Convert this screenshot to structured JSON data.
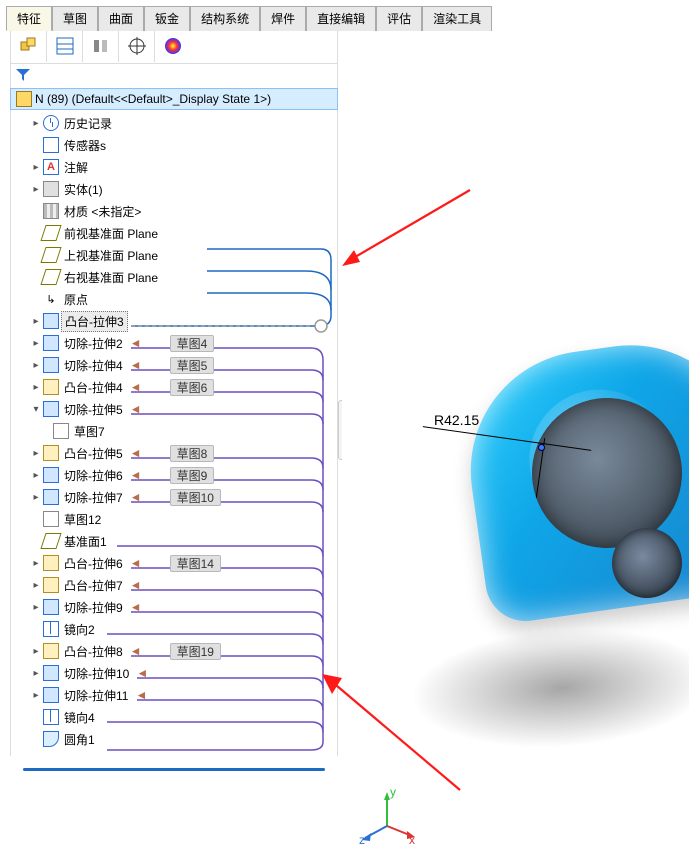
{
  "tabs": {
    "t0": "特征",
    "t1": "草图",
    "t2": "曲面",
    "t3": "钣金",
    "t4": "结构系统",
    "t5": "焊件",
    "t6": "直接编辑",
    "t7": "评估",
    "t8": "渲染工具"
  },
  "breadcrumb": {
    "name": "N (89)",
    "ctx": "(Default<<Defa..."
  },
  "root": {
    "label": "N (89)  (Default<<Default>_Display State 1>)"
  },
  "n": {
    "history": "历史记录",
    "sensors": "传感器s",
    "annotations": "注解",
    "bodies": "实体(1)",
    "material": "材质 <未指定>",
    "front": "前视基准面 Plane",
    "top": "上视基准面 Plane",
    "right": "右视基准面 Plane",
    "origin": "原点",
    "f1": "凸台-拉伸3",
    "f2": "切除-拉伸2",
    "f3": "切除-拉伸4",
    "f4": "凸台-拉伸4",
    "f5": "切除-拉伸5",
    "sk7": "草图7",
    "f6": "凸台-拉伸5",
    "f7": "切除-拉伸6",
    "f8": "切除-拉伸7",
    "sk12": "草图12",
    "pl1": "基准面1",
    "f9": "凸台-拉伸6",
    "f10": "凸台-拉伸7",
    "f11": "切除-拉伸9",
    "mir2": "镜向2",
    "f12": "凸台-拉伸8",
    "f13": "切除-拉伸10",
    "f14": "切除-拉伸11",
    "mir4": "镜向4",
    "fil1": "圆角1"
  },
  "badge": {
    "b2": "草图4",
    "b3": "草图5",
    "b4": "草图6",
    "b6": "草图8",
    "b7": "草图9",
    "b8": "草图10",
    "b9": "草图14",
    "b12": "草图19"
  },
  "dim": {
    "r": "R42.15"
  },
  "triad": {
    "x": "x",
    "y": "y",
    "z": "z"
  }
}
